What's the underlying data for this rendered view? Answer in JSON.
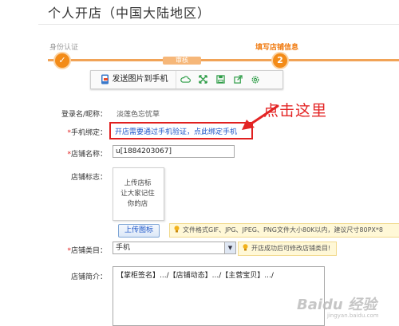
{
  "page": {
    "title": "个人开店（中国大陆地区）"
  },
  "stepper": {
    "step1_label": "身份认证",
    "step1_mark": "✓",
    "mid_label": "审核",
    "step2_label": "填写店铺信息",
    "step2_number": "2"
  },
  "toolbar": {
    "send_label": "发送图片到手机"
  },
  "form": {
    "login_label": "登录名/昵称：",
    "login_value": "淡莲色忘忧草",
    "phone_label": "手机绑定：",
    "phone_value": "开店需要通过手机验证，点此绑定手机",
    "shopname_label": "店铺名称：",
    "shopname_value": "u[1884203067]",
    "logo_label": "店铺标志：",
    "logo_text": "上传店标\n让大家记住\n你的店",
    "upload_button": "上传图标",
    "upload_hint": "文件格式GIF、JPG、JPEG、PNG文件大小80K以内，建议尺寸80PX*8",
    "category_label": "店铺类目：",
    "category_value": "手机",
    "category_hint": "开店成功后可修改店铺类目!",
    "intro_label": "店铺简介：",
    "intro_value": "【掌柜签名】.../【店铺动态】.../【主营宝贝】.../",
    "required_mark": "*"
  },
  "annotation": {
    "text": "点击这里",
    "color": "#e32424"
  },
  "watermark": {
    "text": "Baidu 经验",
    "sub": "jingyan.baidu.com"
  },
  "colors": {
    "accent": "#f38b18",
    "link": "#1e56c8",
    "highlight": "#e02020"
  }
}
